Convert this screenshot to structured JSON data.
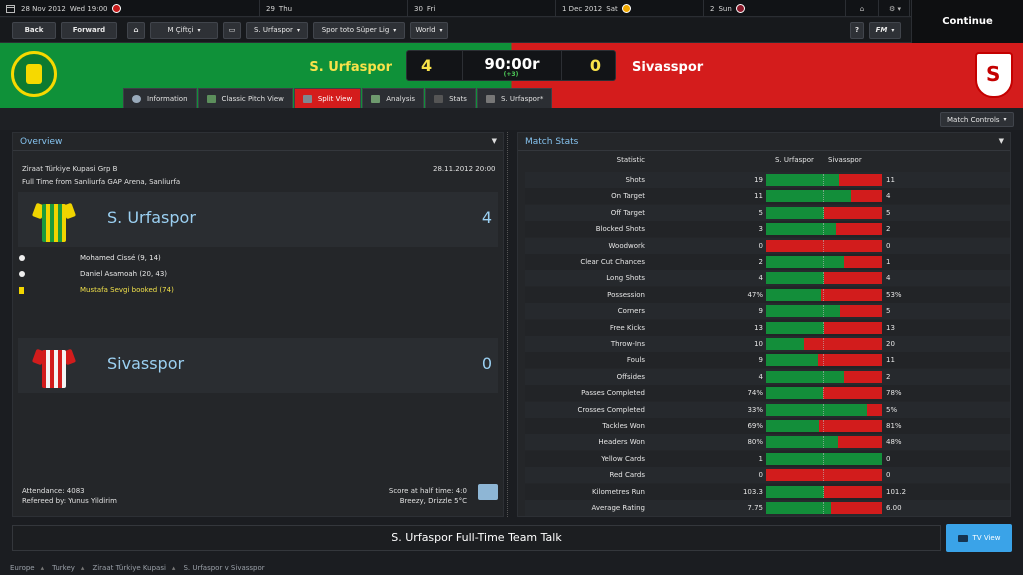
{
  "calendar": [
    {
      "label": "28 Nov 2012",
      "sub": "Wed 19:00",
      "has_badge": true,
      "badge": "red"
    },
    {
      "label": "29",
      "sub": "Thu",
      "has_badge": false
    },
    {
      "label": "30",
      "sub": "Fri",
      "has_badge": false
    },
    {
      "label": "1 Dec 2012",
      "sub": "Sat",
      "has_badge": true,
      "badge": "gold"
    },
    {
      "label": "2",
      "sub": "Sun",
      "has_badge": true,
      "badge": "maroon"
    }
  ],
  "topright": {
    "home": "⌂",
    "settings": "⚙ ▾"
  },
  "continue_label": "Continue",
  "nav": {
    "back": "Back",
    "forward": "Forward",
    "manager": "M Çiftçi",
    "club": "S. Urfaspor",
    "league": "Spor toto Süper Lig",
    "world": "World",
    "help": "?",
    "fm": "FM"
  },
  "match": {
    "home": "S. Urfaspor",
    "away": "Sivasspor",
    "home_score": "4",
    "away_score": "0",
    "clock": "90:00r",
    "added": "(+3)"
  },
  "tabs": [
    "Information",
    "Classic Pitch View",
    "Split View",
    "Analysis",
    "Stats",
    "S. Urfaspor*"
  ],
  "match_controls": "Match Controls",
  "overview": {
    "title": "Overview",
    "competition": "Ziraat Türkiye Kupasi Grp B",
    "date": "28.11.2012 20:00",
    "venue": "Full Time from Sanliurfa GAP Arena, Sanliurfa",
    "home_name": "S. Urfaspor",
    "home_score": "4",
    "away_name": "Sivasspor",
    "away_score": "0",
    "events": [
      {
        "text": "Mohamed Cissé (9, 14)",
        "type": "goal"
      },
      {
        "text": "Daniel Asamoah (20, 43)",
        "type": "goal"
      },
      {
        "text": "Mustafa Sevgi booked (74)",
        "type": "card"
      }
    ],
    "attendance": "Attendance: 4083",
    "referee": "Refereed by: Yunus Yildirim",
    "halftime": "Score at half time: 4:0",
    "weather": "Breezy, Drizzle 5°C"
  },
  "stats": {
    "title": "Match Stats",
    "header": {
      "stat": "Statistic",
      "home": "S. Urfaspor",
      "away": "Sivasspor"
    },
    "rows": [
      {
        "name": "Shots",
        "h": "19",
        "a": "11",
        "p": 0.63
      },
      {
        "name": "On Target",
        "h": "11",
        "a": "4",
        "p": 0.73
      },
      {
        "name": "Off Target",
        "h": "5",
        "a": "5",
        "p": 0.5
      },
      {
        "name": "Blocked Shots",
        "h": "3",
        "a": "2",
        "p": 0.6
      },
      {
        "name": "Woodwork",
        "h": "0",
        "a": "0",
        "p": 0.0
      },
      {
        "name": "Clear Cut Chances",
        "h": "2",
        "a": "1",
        "p": 0.67
      },
      {
        "name": "Long Shots",
        "h": "4",
        "a": "4",
        "p": 0.5
      },
      {
        "name": "Possession",
        "h": "47%",
        "a": "53%",
        "p": 0.47
      },
      {
        "name": "Corners",
        "h": "9",
        "a": "5",
        "p": 0.64
      },
      {
        "name": "Free Kicks",
        "h": "13",
        "a": "13",
        "p": 0.5
      },
      {
        "name": "Throw-Ins",
        "h": "10",
        "a": "20",
        "p": 0.33
      },
      {
        "name": "Fouls",
        "h": "9",
        "a": "11",
        "p": 0.45
      },
      {
        "name": "Offsides",
        "h": "4",
        "a": "2",
        "p": 0.67
      },
      {
        "name": "Passes Completed",
        "h": "74%",
        "a": "78%",
        "p": 0.49
      },
      {
        "name": "Crosses Completed",
        "h": "33%",
        "a": "5%",
        "p": 0.87
      },
      {
        "name": "Tackles Won",
        "h": "69%",
        "a": "81%",
        "p": 0.46
      },
      {
        "name": "Headers Won",
        "h": "80%",
        "a": "48%",
        "p": 0.62
      },
      {
        "name": "Yellow Cards",
        "h": "1",
        "a": "0",
        "p": 1.0
      },
      {
        "name": "Red Cards",
        "h": "0",
        "a": "0",
        "p": 0.0
      },
      {
        "name": "Kilometres Run",
        "h": "103.3",
        "a": "101.2",
        "p": 0.5
      },
      {
        "name": "Average Rating",
        "h": "7.75",
        "a": "6.00",
        "p": 0.56
      }
    ]
  },
  "team_talk": "S. Urfaspor Full-Time Team Talk",
  "tv_view": "TV View",
  "breadcrumb": [
    "Europe",
    "Turkey",
    "Ziraat Türkiye Kupasi",
    "S. Urfaspor v Sivasspor"
  ],
  "colors": {
    "home_green": "#0f9139",
    "away_red": "#d41c1c",
    "accent_blue": "#3aa3e8",
    "score_yellow": "#f8e24a"
  }
}
